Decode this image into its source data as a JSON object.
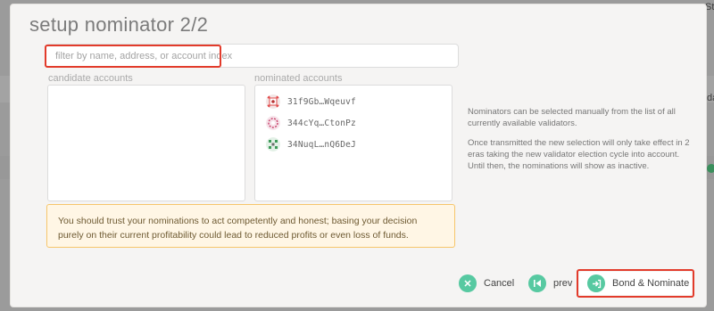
{
  "modal": {
    "title": "setup nominator 2/2"
  },
  "search": {
    "placeholder": "filter by name, address, or account index"
  },
  "candidates": {
    "label": "candidate accounts"
  },
  "nominated": {
    "label": "nominated accounts",
    "items": [
      {
        "address": "31f9Gb…Wqeuvf",
        "icon": "identicon-red-dots",
        "color": "#e14b4b"
      },
      {
        "address": "344cYq…CtonPz",
        "icon": "identicon-pink-ring",
        "color": "#c9466e"
      },
      {
        "address": "34NuqL…nQ6DeJ",
        "icon": "identicon-green-grid",
        "color": "#3f9b5a"
      }
    ]
  },
  "info": {
    "p1": "Nominators can be selected manually from the list of all currently available validators.",
    "p2": "Once transmitted the new selection will only take effect in 2 eras taking the new validator election cycle into account. Until then, the nominations will show as inactive."
  },
  "warning": {
    "text": "You should trust your nominations to act competently and honest; basing your decision purely on their current profitability could lead to reduced profits or even loss of funds."
  },
  "actions": {
    "cancel": "Cancel",
    "prev": "prev",
    "bond": "Bond & Nominate"
  },
  "background": {
    "right_top": "Sta",
    "right_mid": "da"
  },
  "colors": {
    "accent": "#57c9a1",
    "highlight": "#e23b2b",
    "warning_border": "#f7c66b",
    "warning_bg": "#fff6e5"
  }
}
